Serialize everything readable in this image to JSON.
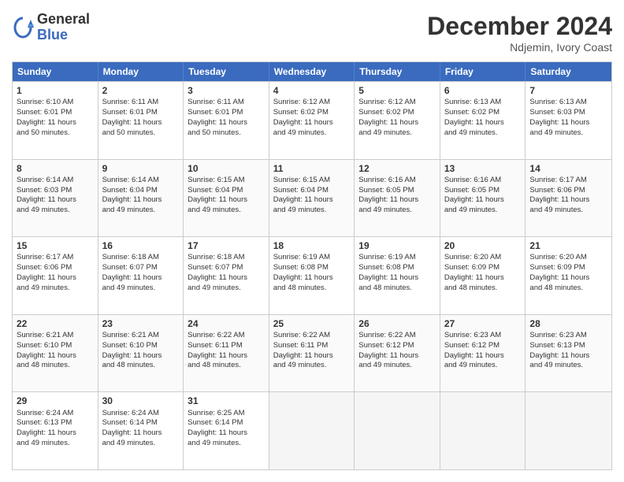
{
  "logo": {
    "general": "General",
    "blue": "Blue"
  },
  "header": {
    "month": "December 2024",
    "location": "Ndjemin, Ivory Coast"
  },
  "weekdays": [
    "Sunday",
    "Monday",
    "Tuesday",
    "Wednesday",
    "Thursday",
    "Friday",
    "Saturday"
  ],
  "rows": [
    [
      {
        "day": "1",
        "lines": [
          "Sunrise: 6:10 AM",
          "Sunset: 6:01 PM",
          "Daylight: 11 hours",
          "and 50 minutes."
        ]
      },
      {
        "day": "2",
        "lines": [
          "Sunrise: 6:11 AM",
          "Sunset: 6:01 PM",
          "Daylight: 11 hours",
          "and 50 minutes."
        ]
      },
      {
        "day": "3",
        "lines": [
          "Sunrise: 6:11 AM",
          "Sunset: 6:01 PM",
          "Daylight: 11 hours",
          "and 50 minutes."
        ]
      },
      {
        "day": "4",
        "lines": [
          "Sunrise: 6:12 AM",
          "Sunset: 6:02 PM",
          "Daylight: 11 hours",
          "and 49 minutes."
        ]
      },
      {
        "day": "5",
        "lines": [
          "Sunrise: 6:12 AM",
          "Sunset: 6:02 PM",
          "Daylight: 11 hours",
          "and 49 minutes."
        ]
      },
      {
        "day": "6",
        "lines": [
          "Sunrise: 6:13 AM",
          "Sunset: 6:02 PM",
          "Daylight: 11 hours",
          "and 49 minutes."
        ]
      },
      {
        "day": "7",
        "lines": [
          "Sunrise: 6:13 AM",
          "Sunset: 6:03 PM",
          "Daylight: 11 hours",
          "and 49 minutes."
        ]
      }
    ],
    [
      {
        "day": "8",
        "lines": [
          "Sunrise: 6:14 AM",
          "Sunset: 6:03 PM",
          "Daylight: 11 hours",
          "and 49 minutes."
        ]
      },
      {
        "day": "9",
        "lines": [
          "Sunrise: 6:14 AM",
          "Sunset: 6:04 PM",
          "Daylight: 11 hours",
          "and 49 minutes."
        ]
      },
      {
        "day": "10",
        "lines": [
          "Sunrise: 6:15 AM",
          "Sunset: 6:04 PM",
          "Daylight: 11 hours",
          "and 49 minutes."
        ]
      },
      {
        "day": "11",
        "lines": [
          "Sunrise: 6:15 AM",
          "Sunset: 6:04 PM",
          "Daylight: 11 hours",
          "and 49 minutes."
        ]
      },
      {
        "day": "12",
        "lines": [
          "Sunrise: 6:16 AM",
          "Sunset: 6:05 PM",
          "Daylight: 11 hours",
          "and 49 minutes."
        ]
      },
      {
        "day": "13",
        "lines": [
          "Sunrise: 6:16 AM",
          "Sunset: 6:05 PM",
          "Daylight: 11 hours",
          "and 49 minutes."
        ]
      },
      {
        "day": "14",
        "lines": [
          "Sunrise: 6:17 AM",
          "Sunset: 6:06 PM",
          "Daylight: 11 hours",
          "and 49 minutes."
        ]
      }
    ],
    [
      {
        "day": "15",
        "lines": [
          "Sunrise: 6:17 AM",
          "Sunset: 6:06 PM",
          "Daylight: 11 hours",
          "and 49 minutes."
        ]
      },
      {
        "day": "16",
        "lines": [
          "Sunrise: 6:18 AM",
          "Sunset: 6:07 PM",
          "Daylight: 11 hours",
          "and 49 minutes."
        ]
      },
      {
        "day": "17",
        "lines": [
          "Sunrise: 6:18 AM",
          "Sunset: 6:07 PM",
          "Daylight: 11 hours",
          "and 49 minutes."
        ]
      },
      {
        "day": "18",
        "lines": [
          "Sunrise: 6:19 AM",
          "Sunset: 6:08 PM",
          "Daylight: 11 hours",
          "and 48 minutes."
        ]
      },
      {
        "day": "19",
        "lines": [
          "Sunrise: 6:19 AM",
          "Sunset: 6:08 PM",
          "Daylight: 11 hours",
          "and 48 minutes."
        ]
      },
      {
        "day": "20",
        "lines": [
          "Sunrise: 6:20 AM",
          "Sunset: 6:09 PM",
          "Daylight: 11 hours",
          "and 48 minutes."
        ]
      },
      {
        "day": "21",
        "lines": [
          "Sunrise: 6:20 AM",
          "Sunset: 6:09 PM",
          "Daylight: 11 hours",
          "and 48 minutes."
        ]
      }
    ],
    [
      {
        "day": "22",
        "lines": [
          "Sunrise: 6:21 AM",
          "Sunset: 6:10 PM",
          "Daylight: 11 hours",
          "and 48 minutes."
        ]
      },
      {
        "day": "23",
        "lines": [
          "Sunrise: 6:21 AM",
          "Sunset: 6:10 PM",
          "Daylight: 11 hours",
          "and 48 minutes."
        ]
      },
      {
        "day": "24",
        "lines": [
          "Sunrise: 6:22 AM",
          "Sunset: 6:11 PM",
          "Daylight: 11 hours",
          "and 48 minutes."
        ]
      },
      {
        "day": "25",
        "lines": [
          "Sunrise: 6:22 AM",
          "Sunset: 6:11 PM",
          "Daylight: 11 hours",
          "and 49 minutes."
        ]
      },
      {
        "day": "26",
        "lines": [
          "Sunrise: 6:22 AM",
          "Sunset: 6:12 PM",
          "Daylight: 11 hours",
          "and 49 minutes."
        ]
      },
      {
        "day": "27",
        "lines": [
          "Sunrise: 6:23 AM",
          "Sunset: 6:12 PM",
          "Daylight: 11 hours",
          "and 49 minutes."
        ]
      },
      {
        "day": "28",
        "lines": [
          "Sunrise: 6:23 AM",
          "Sunset: 6:13 PM",
          "Daylight: 11 hours",
          "and 49 minutes."
        ]
      }
    ],
    [
      {
        "day": "29",
        "lines": [
          "Sunrise: 6:24 AM",
          "Sunset: 6:13 PM",
          "Daylight: 11 hours",
          "and 49 minutes."
        ]
      },
      {
        "day": "30",
        "lines": [
          "Sunrise: 6:24 AM",
          "Sunset: 6:14 PM",
          "Daylight: 11 hours",
          "and 49 minutes."
        ]
      },
      {
        "day": "31",
        "lines": [
          "Sunrise: 6:25 AM",
          "Sunset: 6:14 PM",
          "Daylight: 11 hours",
          "and 49 minutes."
        ]
      },
      null,
      null,
      null,
      null
    ]
  ]
}
